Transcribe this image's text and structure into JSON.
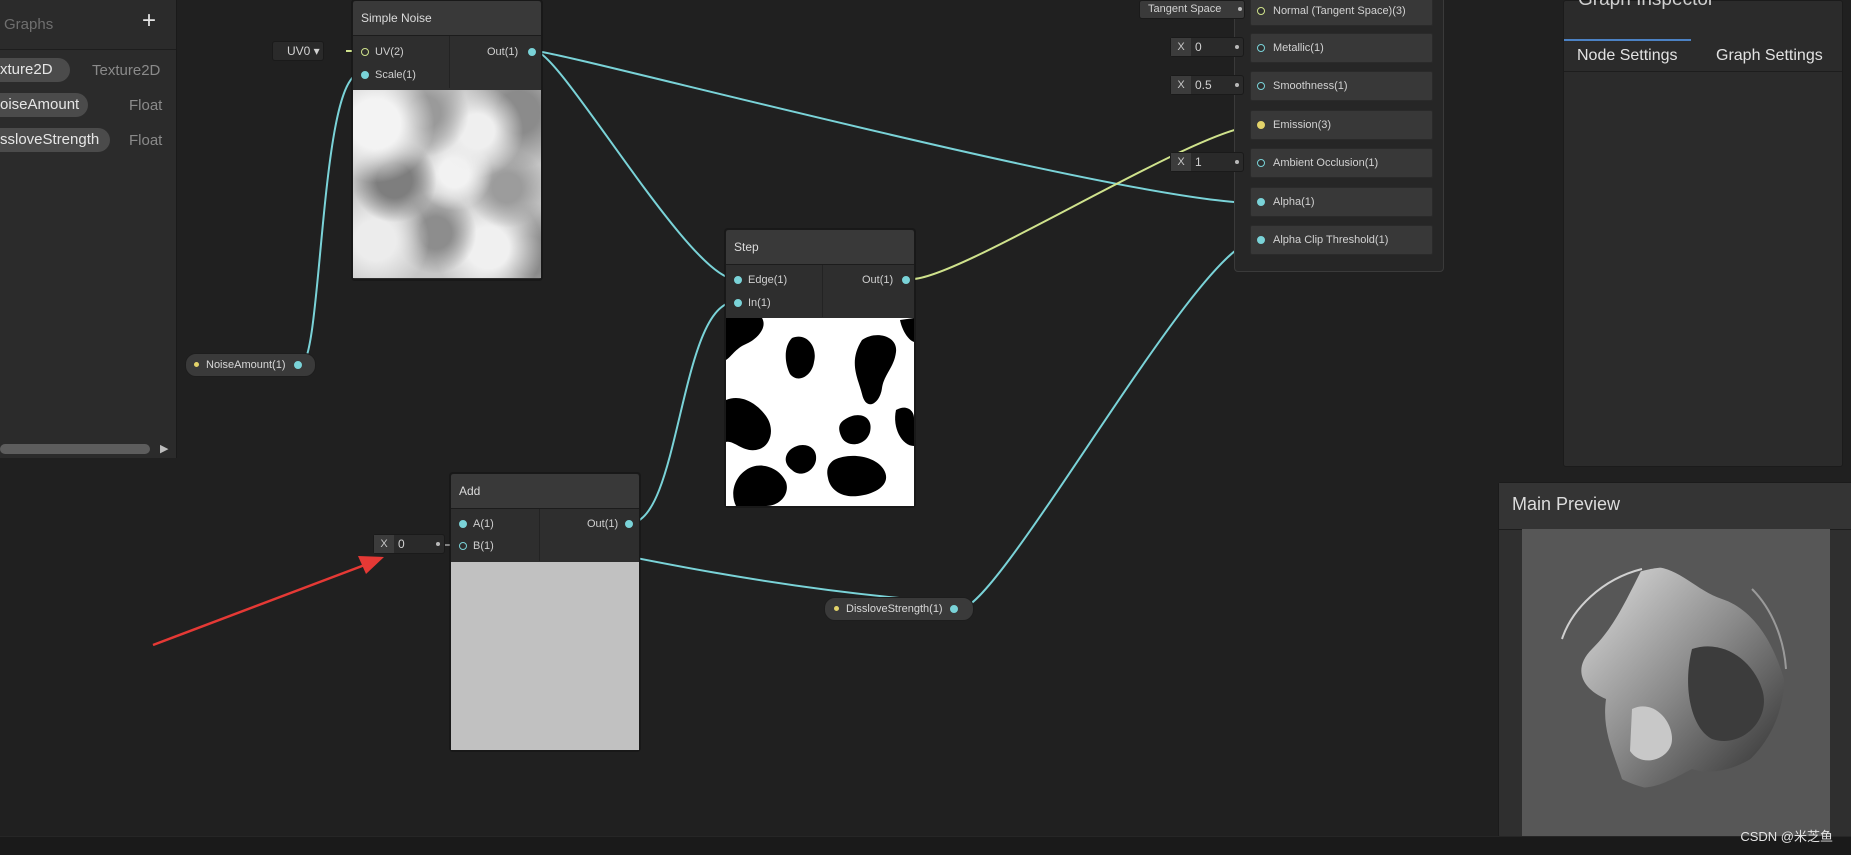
{
  "blackboard": {
    "subtitle": "Graphs",
    "add_label": "+",
    "properties": [
      {
        "name": "xture2D",
        "type": "Texture2D"
      },
      {
        "name": "oiseAmount",
        "type": "Float"
      },
      {
        "name": "ssloveStrength",
        "type": "Float"
      }
    ],
    "scroll_arrow": "▶"
  },
  "nodes": {
    "simple_noise": {
      "title": "Simple Noise",
      "uv_dropdown": "UV0 ▾",
      "inputs": [
        "UV(2)",
        "Scale(1)"
      ],
      "output": "Out(1)"
    },
    "step": {
      "title": "Step",
      "inputs": [
        "Edge(1)",
        "In(1)"
      ],
      "output": "Out(1)"
    },
    "add": {
      "title": "Add",
      "inputs": [
        "A(1)",
        "B(1)"
      ],
      "output": "Out(1)",
      "b_field": {
        "x_label": "X",
        "value": "0"
      }
    }
  },
  "property_nodes": {
    "noise_amount": "NoiseAmount(1)",
    "dissolve_strength": "DissloveStrength(1)"
  },
  "master_stack": {
    "tangent_label": "Tangent Space",
    "slots": [
      {
        "label": "Normal (Tangent Space)(3)",
        "field": ""
      },
      {
        "label": "Metallic(1)",
        "field": "0"
      },
      {
        "label": "Smoothness(1)",
        "field": "0.5"
      },
      {
        "label": "Emission(3)",
        "field": ""
      },
      {
        "label": "Ambient Occlusion(1)",
        "field": "1"
      },
      {
        "label": "Alpha(1)",
        "field": ""
      },
      {
        "label": "Alpha Clip Threshold(1)",
        "field": ""
      }
    ],
    "x_label": "X"
  },
  "inspector": {
    "title": "Graph Inspector",
    "tabs": [
      "Node Settings",
      "Graph Settings"
    ]
  },
  "main_preview": {
    "title": "Main Preview"
  },
  "watermark": "CSDN @米芝鱼",
  "colors": {
    "wire_float": "#7ad3d8",
    "wire_vector3": "#cfe28c",
    "annotation_arrow": "#e53935"
  }
}
